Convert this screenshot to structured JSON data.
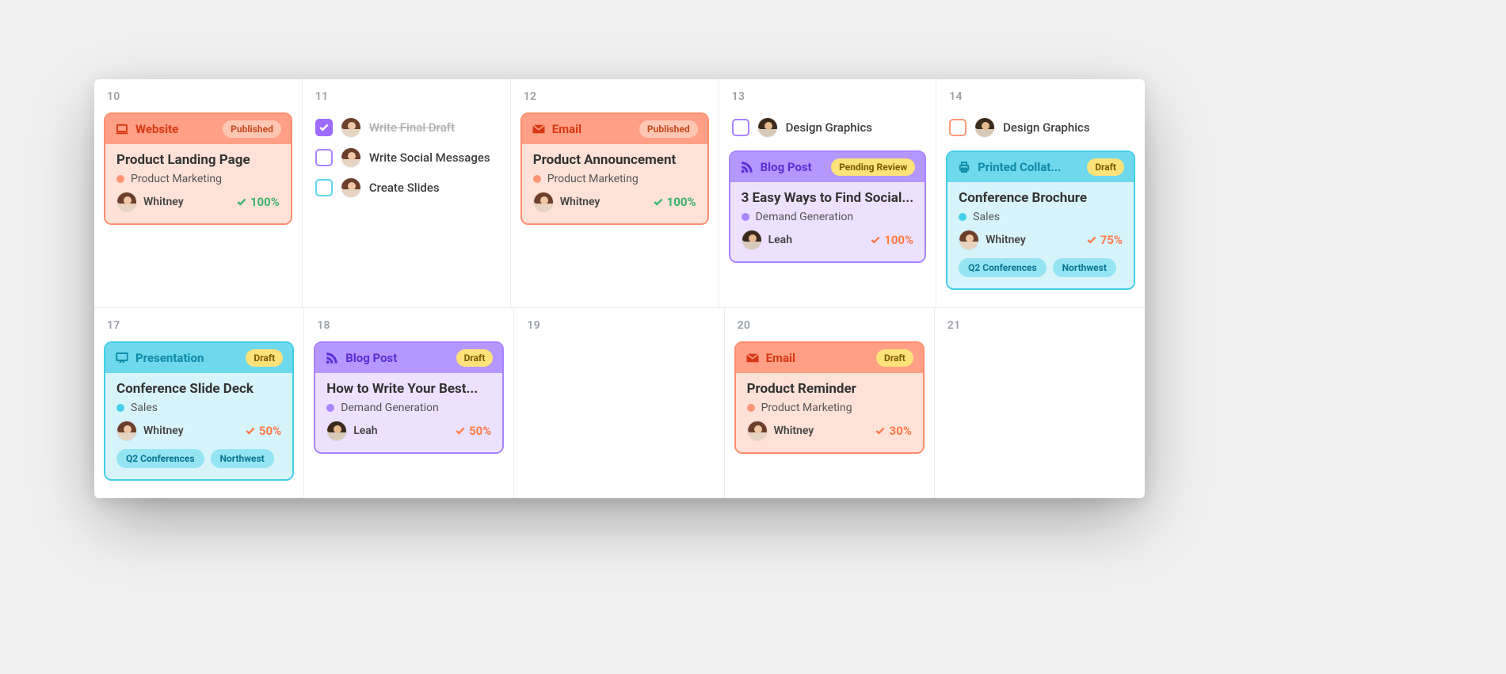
{
  "days": {
    "r0c0": "10",
    "r0c1": "11",
    "r0c2": "12",
    "r0c3": "13",
    "r0c4": "14",
    "r1c0": "17",
    "r1c1": "18",
    "r1c2": "19",
    "r1c3": "20",
    "r1c4": "21"
  },
  "tasks": {
    "d11": [
      {
        "label": "Write Final Draft",
        "done": true,
        "box": "violet",
        "assignee": "whitney"
      },
      {
        "label": "Write Social Messages",
        "done": false,
        "box": "violet",
        "assignee": "whitney"
      },
      {
        "label": "Create Slides",
        "done": false,
        "box": "teal",
        "assignee": "whitney"
      }
    ],
    "d13": [
      {
        "label": "Design Graphics",
        "done": false,
        "box": "violet",
        "assignee": "leah"
      }
    ],
    "d14": [
      {
        "label": "Design Graphics",
        "done": false,
        "box": "orange",
        "assignee": "leah"
      }
    ]
  },
  "cards": {
    "website_10": {
      "type": "Website",
      "status": "Published",
      "title": "Product Landing Page",
      "category": "Product Marketing",
      "cat_color": "orange",
      "assignee": "Whitney",
      "avatar": "whitney",
      "progress": "100%",
      "prog_color": "green"
    },
    "email_12": {
      "type": "Email",
      "status": "Published",
      "title": "Product Announcement",
      "category": "Product Marketing",
      "cat_color": "orange",
      "assignee": "Whitney",
      "avatar": "whitney",
      "progress": "100%",
      "prog_color": "green"
    },
    "blog_13": {
      "type": "Blog Post",
      "status": "Pending Review",
      "title": "3 Easy Ways to Find Social...",
      "category": "Demand Generation",
      "cat_color": "violet",
      "assignee": "Leah",
      "avatar": "leah",
      "progress": "100%",
      "prog_color": "orange"
    },
    "print_14": {
      "type": "Printed Collat...",
      "status": "Draft",
      "title": "Conference Brochure",
      "category": "Sales",
      "cat_color": "teal",
      "assignee": "Whitney",
      "avatar": "whitney",
      "progress": "75%",
      "prog_color": "orange",
      "tags": [
        "Q2 Conferences",
        "Northwest"
      ]
    },
    "pres_17": {
      "type": "Presentation",
      "status": "Draft",
      "title": "Conference Slide Deck",
      "category": "Sales",
      "cat_color": "teal",
      "assignee": "Whitney",
      "avatar": "whitney",
      "progress": "50%",
      "prog_color": "orange",
      "tags": [
        "Q2 Conferences",
        "Northwest"
      ]
    },
    "blog_18": {
      "type": "Blog Post",
      "status": "Draft",
      "title": "How to Write Your Best...",
      "category": "Demand Generation",
      "cat_color": "violet",
      "assignee": "Leah",
      "avatar": "leah",
      "progress": "50%",
      "prog_color": "orange"
    },
    "email_20": {
      "type": "Email",
      "status": "Draft",
      "title": "Product Reminder",
      "category": "Product Marketing",
      "cat_color": "orange",
      "assignee": "Whitney",
      "avatar": "whitney",
      "progress": "30%",
      "prog_color": "orange"
    }
  }
}
